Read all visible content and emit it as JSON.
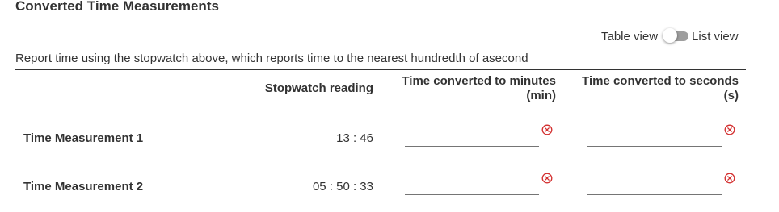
{
  "section": {
    "title": "Converted Time Measurements"
  },
  "view_toggle": {
    "left_label": "Table view",
    "right_label": "List view",
    "state": "off"
  },
  "instructions": "Report time using the stopwatch above, which reports time to the nearest hundredth of asecond",
  "table": {
    "columns": [
      "",
      "Stopwatch reading",
      "Time converted to minutes (min)",
      "Time converted to seconds (s)"
    ],
    "rows": [
      {
        "label": "Time Measurement 1",
        "stopwatch_reading": "13 : 46",
        "minutes_value": "",
        "seconds_value": "",
        "minutes_status": "incorrect",
        "seconds_status": "incorrect"
      },
      {
        "label": "Time Measurement 2",
        "stopwatch_reading": "05 : 50 : 33",
        "minutes_value": "",
        "seconds_value": "",
        "minutes_status": "incorrect",
        "seconds_status": "incorrect"
      }
    ]
  },
  "colors": {
    "error": "#d32f2f",
    "text": "#333333",
    "toggle_track": "#9e9e9e"
  },
  "icons": {
    "status": "error-x-circle-icon"
  }
}
